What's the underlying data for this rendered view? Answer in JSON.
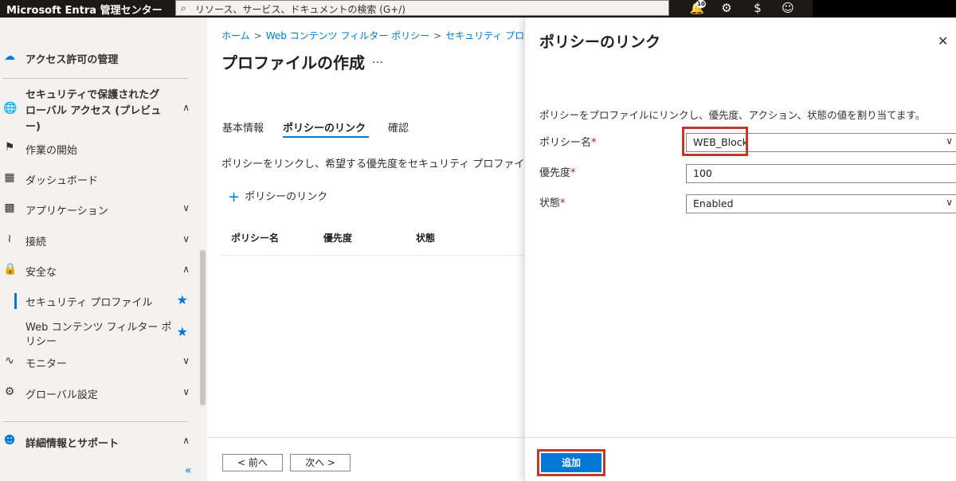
{
  "topbar": {
    "brand": "Microsoft Entra 管理センター",
    "search_placeholder": "リソース、サービス、ドキュメントの検索 (G+/)",
    "notification_count": "10"
  },
  "sidebar": {
    "items": [
      {
        "label": "アクセス許可の管理"
      },
      {
        "label": "セキュリティで保護されたグ"
      },
      {
        "label": "ローバル アクセス (プレビュ"
      },
      {
        "label": "ー)"
      },
      {
        "label": "作業の開始"
      },
      {
        "label": "ダッシュボード"
      },
      {
        "label": "アプリケーション"
      },
      {
        "label": "接続"
      },
      {
        "label": "安全な"
      },
      {
        "label": "セキュリティ プロファイル"
      },
      {
        "label": "Web コンテンツ フィルター ポ"
      },
      {
        "label": "リシー"
      },
      {
        "label": "モニター"
      },
      {
        "label": "グローバル設定"
      },
      {
        "label": "詳細情報とサポート"
      }
    ]
  },
  "main": {
    "breadcrumb": [
      "ホーム",
      "Web コンテンツ フィルター ポリシー",
      "セキュリティ プロファイル"
    ],
    "title": "プロファイルの作成",
    "more": "…",
    "tabs": [
      {
        "label": "基本情報"
      },
      {
        "label": "ポリシーのリンク"
      },
      {
        "label": "確認"
      }
    ],
    "description": "ポリシーをリンクし、希望する優先度をセキュリティ プロファイル",
    "add_link": "ポリシーのリンク",
    "columns": [
      "ポリシー名",
      "優先度",
      "状態"
    ],
    "prev_button": "< 前へ",
    "next_button": "次へ >"
  },
  "panel": {
    "title": "ポリシーのリンク",
    "description": "ポリシーをプロファイルにリンクし、優先度、アクション、状態の値を割り当てます。",
    "fields": [
      {
        "label": "ポリシー名",
        "value": "WEB_Block"
      },
      {
        "label": "優先度",
        "value": "100"
      },
      {
        "label": "状態",
        "value": "Enabled"
      }
    ],
    "add_button": "追加"
  }
}
